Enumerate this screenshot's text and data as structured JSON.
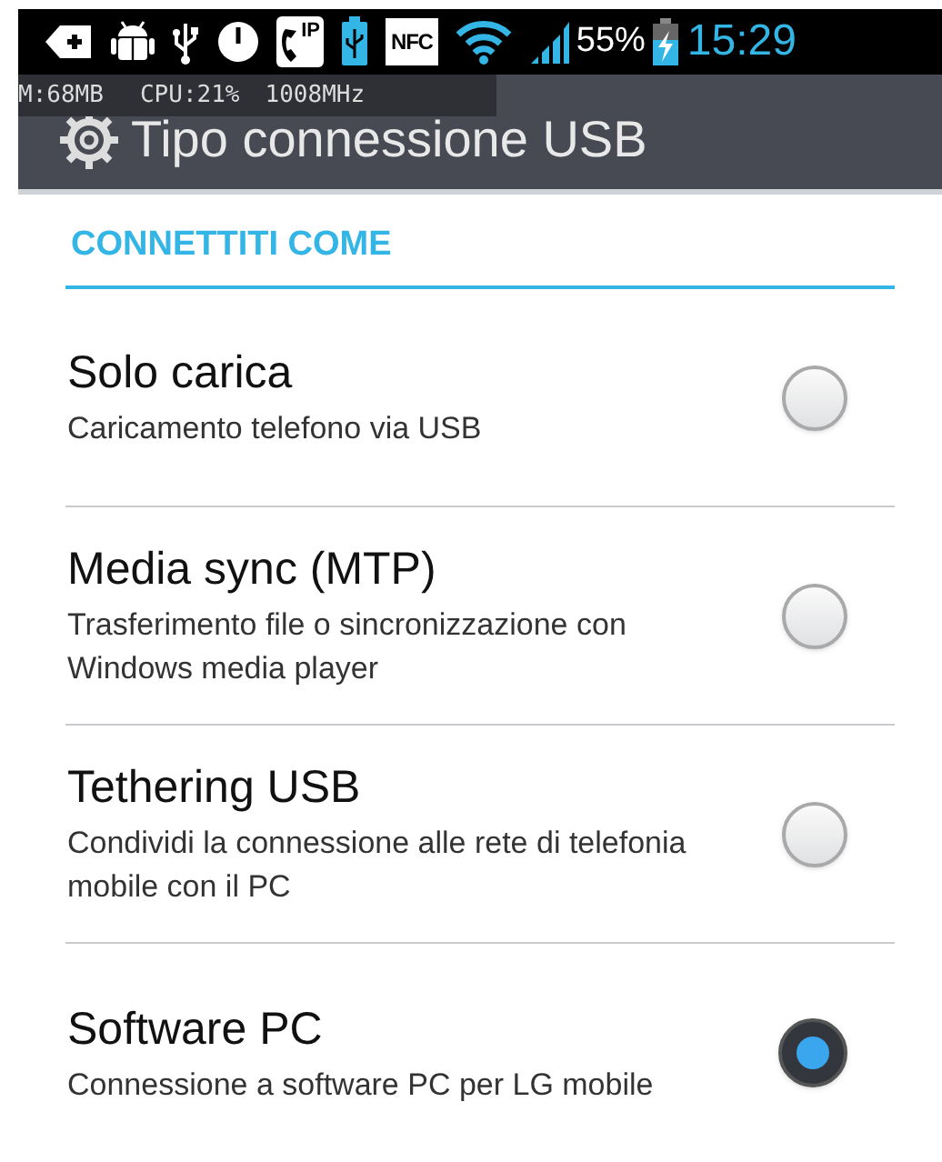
{
  "status_bar": {
    "phone_icon_label": "IP",
    "nfc_label": "NFC",
    "battery": "55%",
    "time": "15:29"
  },
  "overlay": {
    "memory": "M:68MB",
    "cpu": "CPU:21%",
    "frequency": "1008MHz"
  },
  "title": "Tipo connessione USB",
  "section": "CONNETTITI COME",
  "options": [
    {
      "title": "Solo carica",
      "summary": "Caricamento telefono via USB",
      "selected": false
    },
    {
      "title": "Media sync (MTP)",
      "summary": "Trasferimento file o sincronizzazione con Windows media player",
      "selected": false
    },
    {
      "title": "Tethering USB",
      "summary": "Condividi la connessione alle rete di telefonia mobile con il PC",
      "selected": false
    },
    {
      "title": "Software PC",
      "summary": "Connessione a software PC per LG mobile",
      "selected": true
    }
  ]
}
